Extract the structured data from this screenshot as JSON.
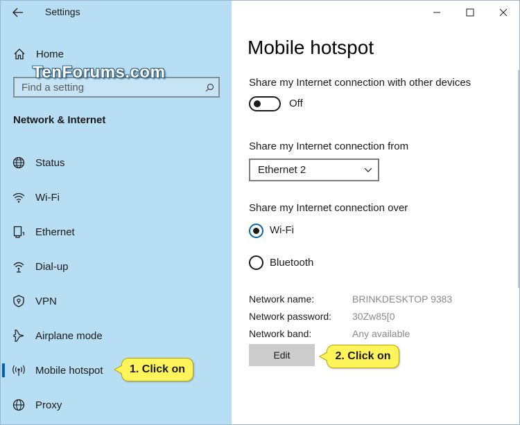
{
  "app": {
    "title": "Settings"
  },
  "sidebar": {
    "home_label": "Home",
    "search_placeholder": "Find a setting",
    "section_heading": "Network & Internet",
    "items": [
      {
        "label": "Status",
        "icon": "globe-icon"
      },
      {
        "label": "Wi-Fi",
        "icon": "wifi-icon"
      },
      {
        "label": "Ethernet",
        "icon": "ethernet-icon"
      },
      {
        "label": "Dial-up",
        "icon": "dialup-icon"
      },
      {
        "label": "VPN",
        "icon": "vpn-icon"
      },
      {
        "label": "Airplane mode",
        "icon": "airplane-icon"
      },
      {
        "label": "Mobile hotspot",
        "icon": "hotspot-icon",
        "active": true
      },
      {
        "label": "Proxy",
        "icon": "proxy-icon"
      }
    ]
  },
  "watermark": "TenForums.com",
  "main": {
    "title": "Mobile hotspot",
    "share_label": "Share my Internet connection with other devices",
    "toggle_state": "Off",
    "toggle_on": false,
    "share_from_label": "Share my Internet connection from",
    "share_from_value": "Ethernet 2",
    "share_over_label": "Share my Internet connection over",
    "radio_wifi": "Wi-Fi",
    "radio_bluetooth": "Bluetooth",
    "selected_radio": "Wi-Fi",
    "props": {
      "name_label": "Network name:",
      "name_value": "BRINKDESKTOP 9383",
      "password_label": "Network password:",
      "password_value": "30Zw85[0",
      "band_label": "Network band:",
      "band_value": "Any available"
    },
    "edit_label": "Edit"
  },
  "callouts": {
    "step1": "1. Click on",
    "step2": "2. Click on"
  },
  "colors": {
    "sidebar_bg": "#b7def2",
    "accent": "#0063b1",
    "callout_bg": "#fff55a"
  }
}
